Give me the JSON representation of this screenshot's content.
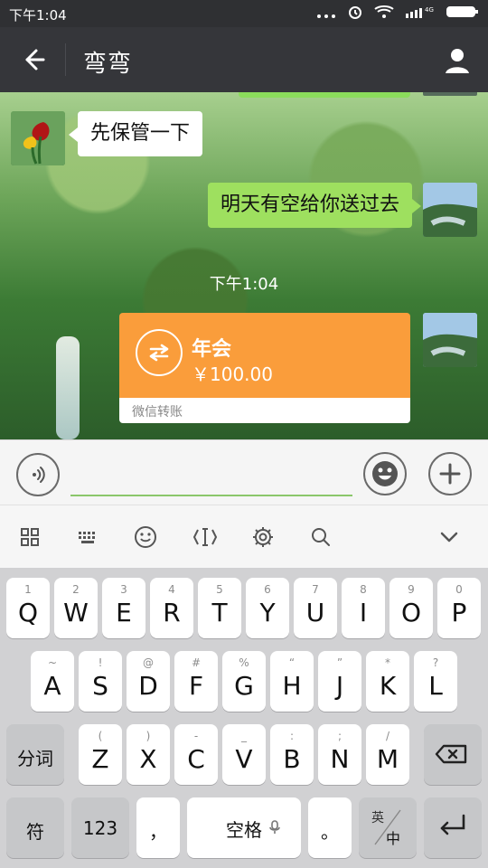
{
  "status_bar": {
    "time": "下午1:04",
    "network": "4G"
  },
  "header": {
    "title": "弯弯"
  },
  "chat": {
    "messages": [
      {
        "side": "left",
        "text": "先保管一下"
      },
      {
        "side": "right",
        "text": "明天有空给你送过去"
      }
    ],
    "timestamp": "下午1:04",
    "transfer": {
      "title": "年会",
      "amount": "￥100.00",
      "label": "微信转账"
    }
  },
  "input": {
    "placeholder": ""
  },
  "keyboard": {
    "row1": [
      {
        "num": "1",
        "letter": "Q"
      },
      {
        "num": "2",
        "letter": "W"
      },
      {
        "num": "3",
        "letter": "E"
      },
      {
        "num": "4",
        "letter": "R"
      },
      {
        "num": "5",
        "letter": "T"
      },
      {
        "num": "6",
        "letter": "Y"
      },
      {
        "num": "7",
        "letter": "U"
      },
      {
        "num": "8",
        "letter": "I"
      },
      {
        "num": "9",
        "letter": "O"
      },
      {
        "num": "0",
        "letter": "P"
      }
    ],
    "row2": [
      {
        "num": "~",
        "letter": "A"
      },
      {
        "num": "!",
        "letter": "S"
      },
      {
        "num": "@",
        "letter": "D"
      },
      {
        "num": "#",
        "letter": "F"
      },
      {
        "num": "%",
        "letter": "G"
      },
      {
        "num": "“",
        "letter": "H"
      },
      {
        "num": "”",
        "letter": "J"
      },
      {
        "num": "*",
        "letter": "K"
      },
      {
        "num": "?",
        "letter": "L"
      }
    ],
    "row3": [
      {
        "num": "(",
        "letter": "Z"
      },
      {
        "num": ")",
        "letter": "X"
      },
      {
        "num": "-",
        "letter": "C"
      },
      {
        "num": "_",
        "letter": "V"
      },
      {
        "num": ":",
        "letter": "B"
      },
      {
        "num": ";",
        "letter": "N"
      },
      {
        "num": "/",
        "letter": "M"
      }
    ],
    "labels": {
      "fenci": "分词",
      "symbol": "符",
      "numbers": "123",
      "comma": "，",
      "space": "空格",
      "period": "。",
      "lang_en": "英",
      "lang_zh": "中"
    }
  },
  "colors": {
    "title_bar": "#35363a",
    "bubble_right": "#9ee05f",
    "transfer_orange": "#fa9d3b",
    "input_underline": "#8ac66a"
  },
  "icons": {
    "status": [
      "dots-icon",
      "alarm-icon",
      "wifi-icon",
      "signal-icon",
      "battery-icon"
    ],
    "header": [
      "back-arrow-icon",
      "profile-icon"
    ],
    "input": [
      "voice-icon",
      "emoji-icon",
      "plus-icon"
    ],
    "toolbar": [
      "grid-icon",
      "keyboard-icon",
      "smile-icon",
      "cursor-icon",
      "settings-icon",
      "search-icon",
      "chevron-down-icon"
    ],
    "keyboard": [
      "backspace-icon",
      "enter-icon",
      "microphone-icon"
    ]
  }
}
